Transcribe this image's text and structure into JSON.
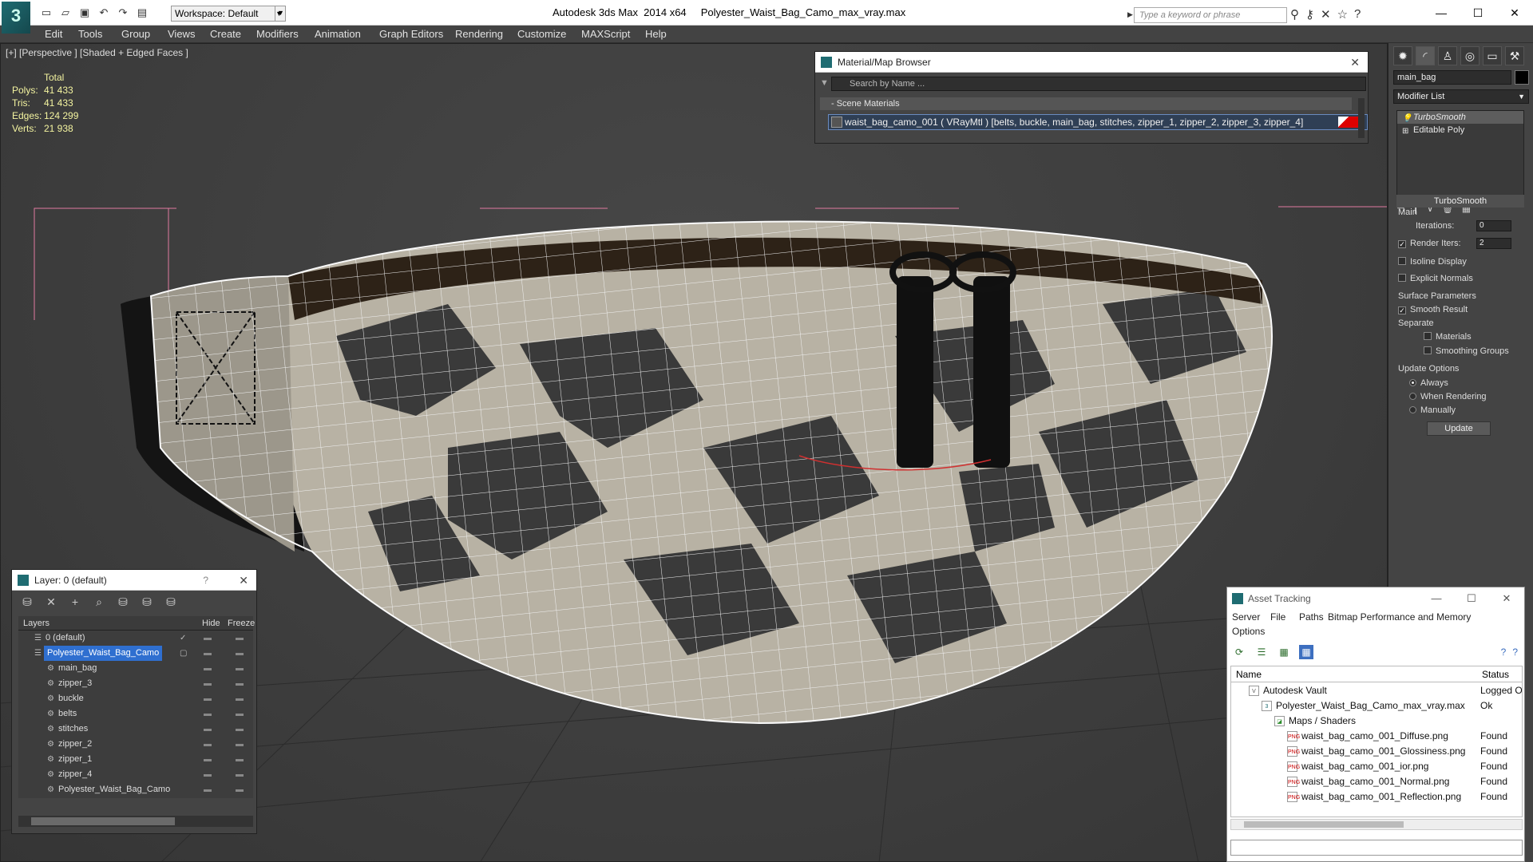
{
  "app": {
    "title": "Autodesk 3ds Max  2014 x64     Polyester_Waist_Bag_Camo_max_vray.max",
    "workspace": "Workspace: Default",
    "search_placeholder": "Type a keyword or phrase"
  },
  "menu": [
    "Edit",
    "Tools",
    "Group",
    "Views",
    "Create",
    "Modifiers",
    "Animation",
    "Graph Editors",
    "Rendering",
    "Customize",
    "MAXScript",
    "Help"
  ],
  "viewport": {
    "label": "[+] [Perspective ] [Shaded + Edged Faces ]",
    "stats_header": "Total",
    "stats": [
      {
        "label": "Polys:",
        "value": "41 433"
      },
      {
        "label": "Tris:",
        "value": "41 433"
      },
      {
        "label": "Edges:",
        "value": "124 299"
      },
      {
        "label": "Verts:",
        "value": "21 938"
      }
    ]
  },
  "material_browser": {
    "title": "Material/Map Browser",
    "search": "Search by Name ...",
    "section": "- Scene Materials",
    "material": "waist_bag_camo_001  ( VRayMtl )  [belts, buckle, main_bag, stitches, zipper_1, zipper_2, zipper_3, zipper_4]"
  },
  "command_panel": {
    "object_name": "main_bag",
    "modifier_list": "Modifier List",
    "stack": [
      "TurboSmooth",
      "Editable Poly"
    ],
    "rollout": "TurboSmooth",
    "main_label": "Main",
    "iterations_label": "Iterations:",
    "iterations_value": "0",
    "render_iters_label": "Render Iters:",
    "render_iters_value": "2",
    "isoline": "Isoline Display",
    "explicit_normals": "Explicit Normals",
    "surface_params": "Surface Parameters",
    "smooth_result": "Smooth Result",
    "separate": "Separate",
    "materials": "Materials",
    "smoothing_groups": "Smoothing Groups",
    "update_options": "Update Options",
    "always": "Always",
    "when_rendering": "When Rendering",
    "manually": "Manually",
    "update_button": "Update"
  },
  "layer_panel": {
    "title": "Layer: 0 (default)",
    "col_layers": "Layers",
    "col_hide": "Hide",
    "col_freeze": "Freeze",
    "rows": [
      {
        "name": "0 (default)"
      },
      {
        "name": "Polyester_Waist_Bag_Camo"
      },
      {
        "name": "main_bag"
      },
      {
        "name": "zipper_3"
      },
      {
        "name": "buckle"
      },
      {
        "name": "belts"
      },
      {
        "name": "stitches"
      },
      {
        "name": "zipper_2"
      },
      {
        "name": "zipper_1"
      },
      {
        "name": "zipper_4"
      },
      {
        "name": "Polyester_Waist_Bag_Camo"
      }
    ]
  },
  "asset_tracking": {
    "title": "Asset Tracking",
    "menu": [
      "Server",
      "File",
      "Paths",
      "Bitmap Performance and Memory",
      "Options"
    ],
    "col_name": "Name",
    "col_status": "Status",
    "rows": [
      {
        "name": "Autodesk Vault",
        "status": "Logged Ou"
      },
      {
        "name": "Polyester_Waist_Bag_Camo_max_vray.max",
        "status": "Ok"
      },
      {
        "name": "Maps / Shaders",
        "status": ""
      },
      {
        "name": "waist_bag_camo_001_Diffuse.png",
        "status": "Found"
      },
      {
        "name": "waist_bag_camo_001_Glossiness.png",
        "status": "Found"
      },
      {
        "name": "waist_bag_camo_001_ior.png",
        "status": "Found"
      },
      {
        "name": "waist_bag_camo_001_Normal.png",
        "status": "Found"
      },
      {
        "name": "waist_bag_camo_001_Reflection.png",
        "status": "Found"
      }
    ]
  }
}
